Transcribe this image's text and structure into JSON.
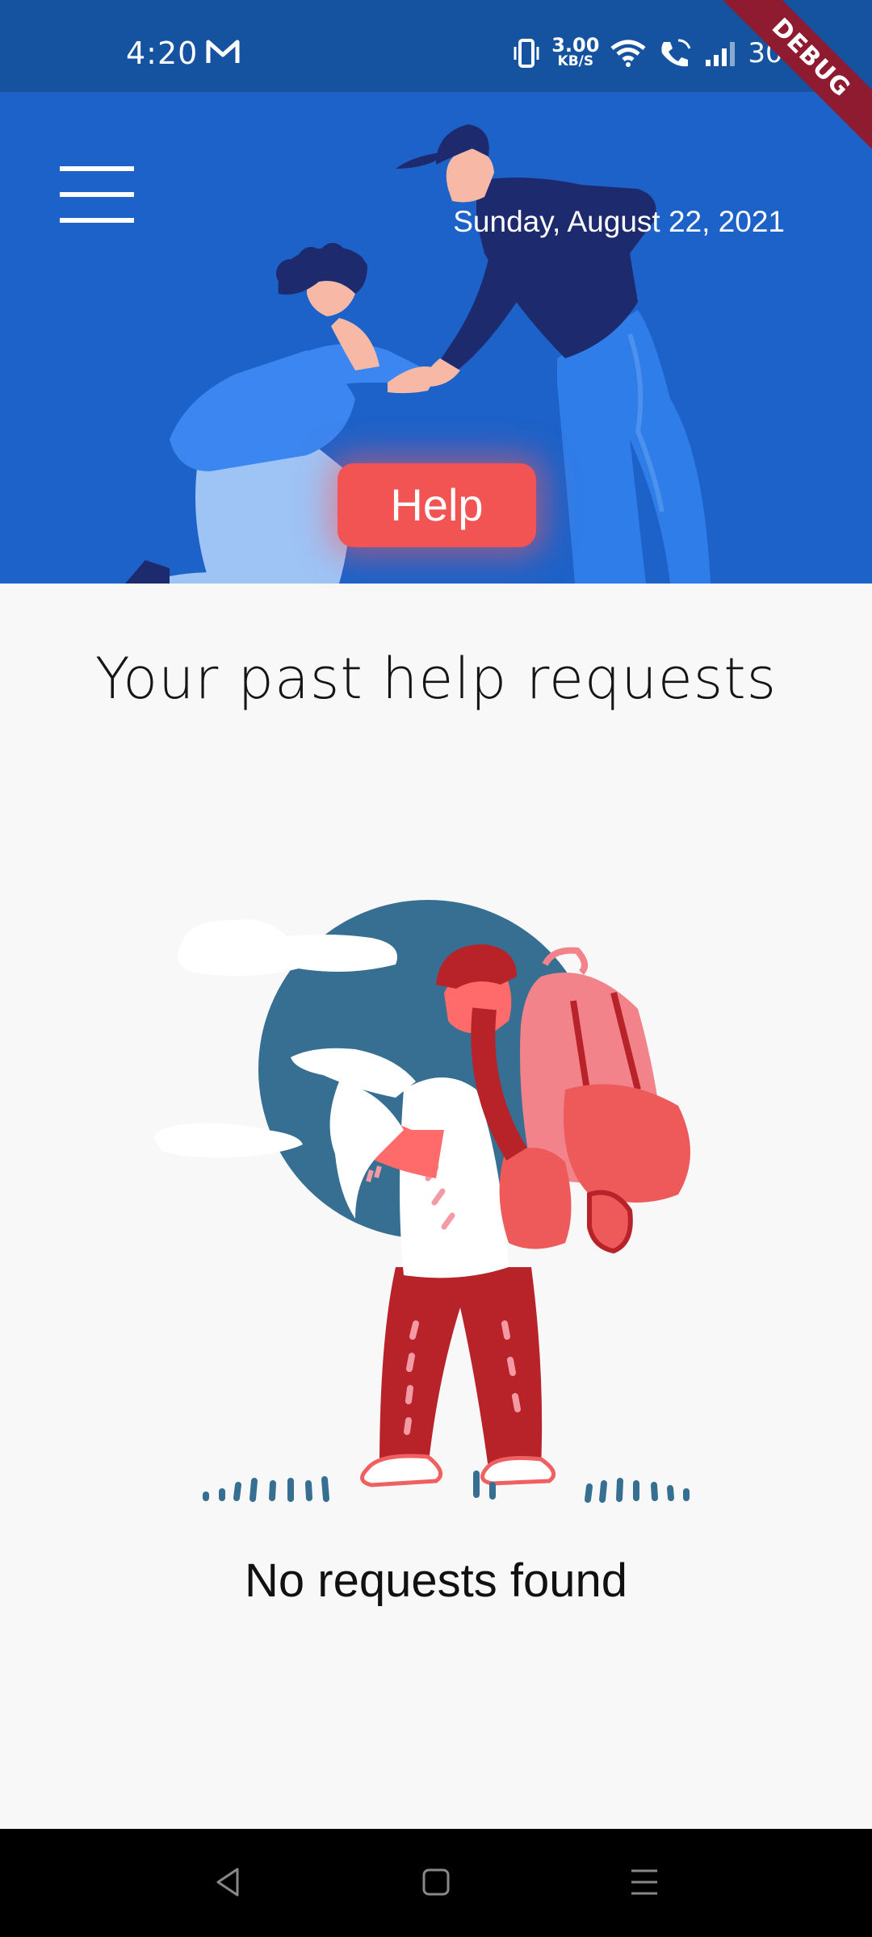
{
  "status_bar": {
    "time": "4:20",
    "net_speed_value": "3.00",
    "net_speed_unit": "KB/S",
    "battery": "30%"
  },
  "debug_banner": "DEBUG",
  "header": {
    "date": "Sunday, August 22, 2021",
    "help_button_label": "Help"
  },
  "main": {
    "title": "Your past help requests",
    "empty_message": "No requests found"
  },
  "colors": {
    "header_blue": "#1d62c9",
    "status_blue": "#1553a1",
    "help_red": "#f25454",
    "background": "#f8f8f8"
  }
}
